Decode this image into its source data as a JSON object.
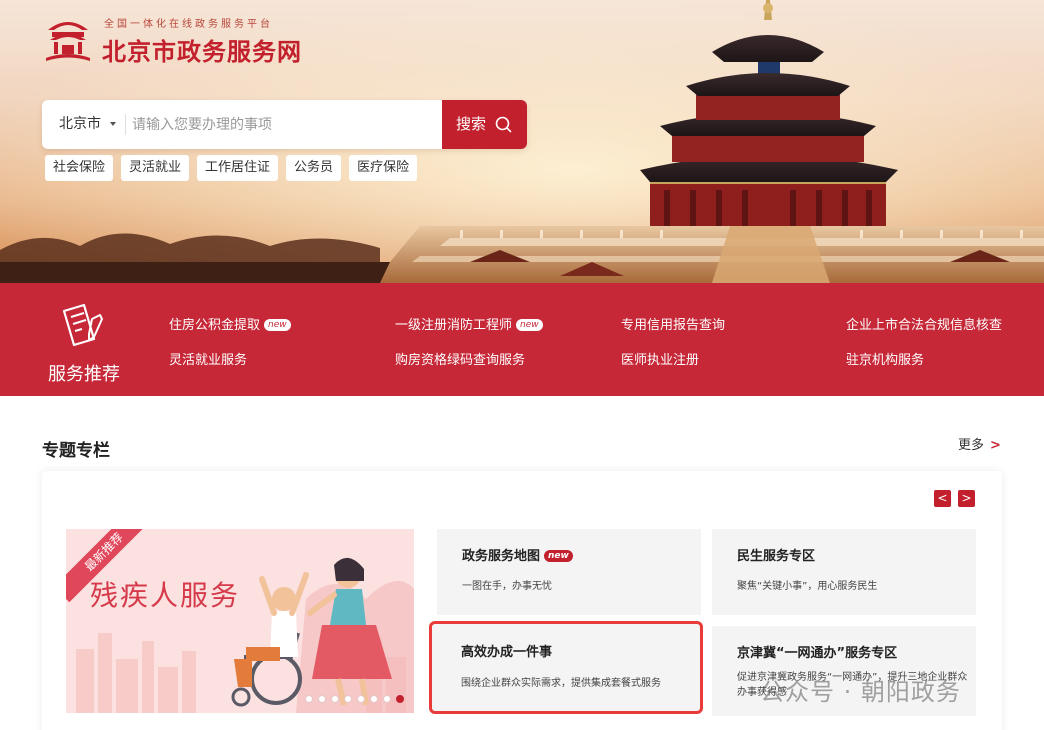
{
  "site": {
    "slogan": "全国一体化在线政务服务平台",
    "name": "北京市政务服务网"
  },
  "search": {
    "city": "北京市",
    "placeholder": "请输入您要办理的事项",
    "button_label": "搜索"
  },
  "hot_tags": [
    "社会保险",
    "灵活就业",
    "工作居住证",
    "公务员",
    "医疗保险"
  ],
  "service_band": {
    "title": "服务推荐",
    "items": [
      {
        "label": "住房公积金提取",
        "badge": "new"
      },
      {
        "label": "一级注册消防工程师",
        "badge": "new"
      },
      {
        "label": "专用信用报告查询"
      },
      {
        "label": "企业上市合法合规信息核查"
      },
      {
        "label": "灵活就业服务"
      },
      {
        "label": "购房资格绿码查询服务"
      },
      {
        "label": "医师执业注册"
      },
      {
        "label": "驻京机构服务"
      }
    ]
  },
  "topics": {
    "title": "专题专栏",
    "more_label": "更多",
    "more_chevron": ">",
    "prev_arrow": "<",
    "next_arrow": ">",
    "banner": {
      "ribbon": "最新推荐",
      "title": "残疾人服务",
      "dot_count": 8,
      "active_dot": 8
    },
    "cards": [
      {
        "title": "政务服务地图",
        "badge": "new",
        "desc": "一图在手，办事无忧"
      },
      {
        "title": "民生服务专区",
        "desc": "聚焦“关键小事”，用心服务民生"
      },
      {
        "title": "高效办成一件事",
        "desc": "围绕企业群众实际需求，提供集成套餐式服务",
        "highlighted": true
      },
      {
        "title": "京津冀“一网通办”服务专区",
        "desc": "促进京津冀政务服务“一网通办”，提升三地企业群众办事获得感"
      }
    ]
  },
  "watermark": "公众号 · 朝阳政务",
  "colors": {
    "brand_red": "#c3202d",
    "band_red": "#c72838",
    "highlight_border": "#ea3b3b"
  },
  "icons": {
    "search": "search-icon",
    "emblem": "beijing-emblem-icon",
    "service": "document-pen-icon"
  }
}
